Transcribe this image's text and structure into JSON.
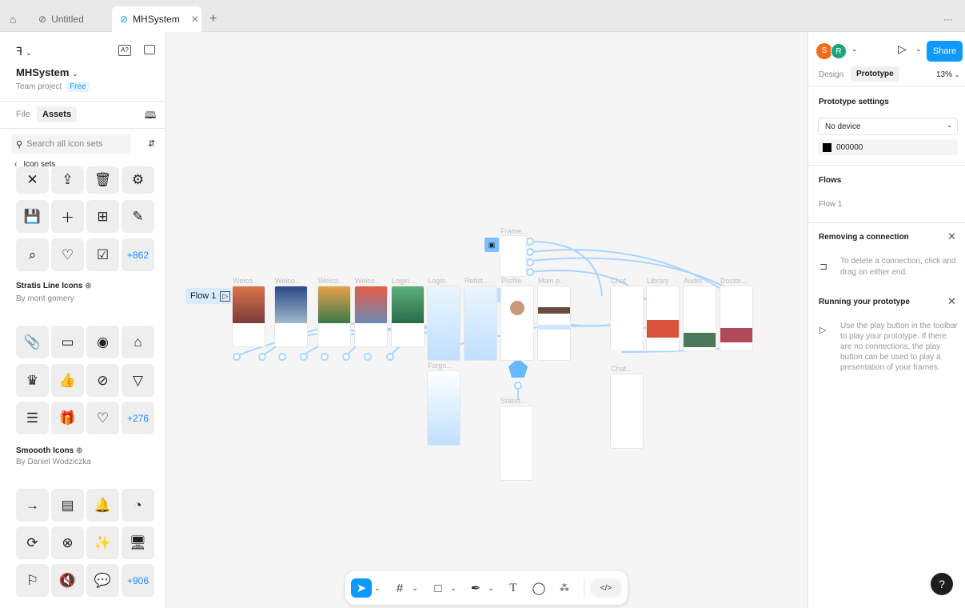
{
  "tabs": {
    "home_icon": "home-icon",
    "untitled": "Untitled",
    "active": "MHSystem",
    "close": "✕",
    "new": "+",
    "more": "···"
  },
  "left": {
    "project_name": "MHSystem",
    "team_project": "Team project",
    "plan_badge": "Free",
    "tab_file": "File",
    "tab_assets": "Assets",
    "search_placeholder": "Search all icon sets",
    "back_label": "Icon sets",
    "set1": {
      "more": "+862"
    },
    "set2": {
      "name": "Stratis Line Icons",
      "author": "By mont gomery",
      "more": "+276"
    },
    "set3": {
      "name": "Smoooth Icons",
      "author": "By Daniel Wodziczka",
      "more": "+906"
    }
  },
  "canvas": {
    "flow_label": "Flow 1",
    "frames": [
      "Welco...",
      "Welco...",
      "Welco...",
      "Welco...",
      "Login ...",
      "Login",
      "Refist...",
      "Profile",
      "Main p...",
      "Chat",
      "Library",
      "Audio",
      "Doctor...",
      "Frame...",
      "Forgo...",
      "Statist...",
      "Chat..."
    ]
  },
  "right": {
    "avatar_s": "S",
    "avatar_r": "R",
    "share": "Share",
    "tab_design": "Design",
    "tab_prototype": "Prototype",
    "zoom": "13%",
    "proto_settings": "Prototype settings",
    "device": "No device",
    "bg_color": "000000",
    "flows_title": "Flows",
    "flow_item": "Flow 1",
    "remove_title": "Removing a connection",
    "remove_text": "To delete a connection, click and drag on either end.",
    "run_title": "Running your prototype",
    "run_text": "Use the play button in the toolbar to play your prototype. If there are no connections, the play button can be used to play a presentation of your frames."
  },
  "colors": {
    "accent": "#0d99ff",
    "avatar_s": "#f26c1d",
    "avatar_r": "#1fa37a"
  }
}
